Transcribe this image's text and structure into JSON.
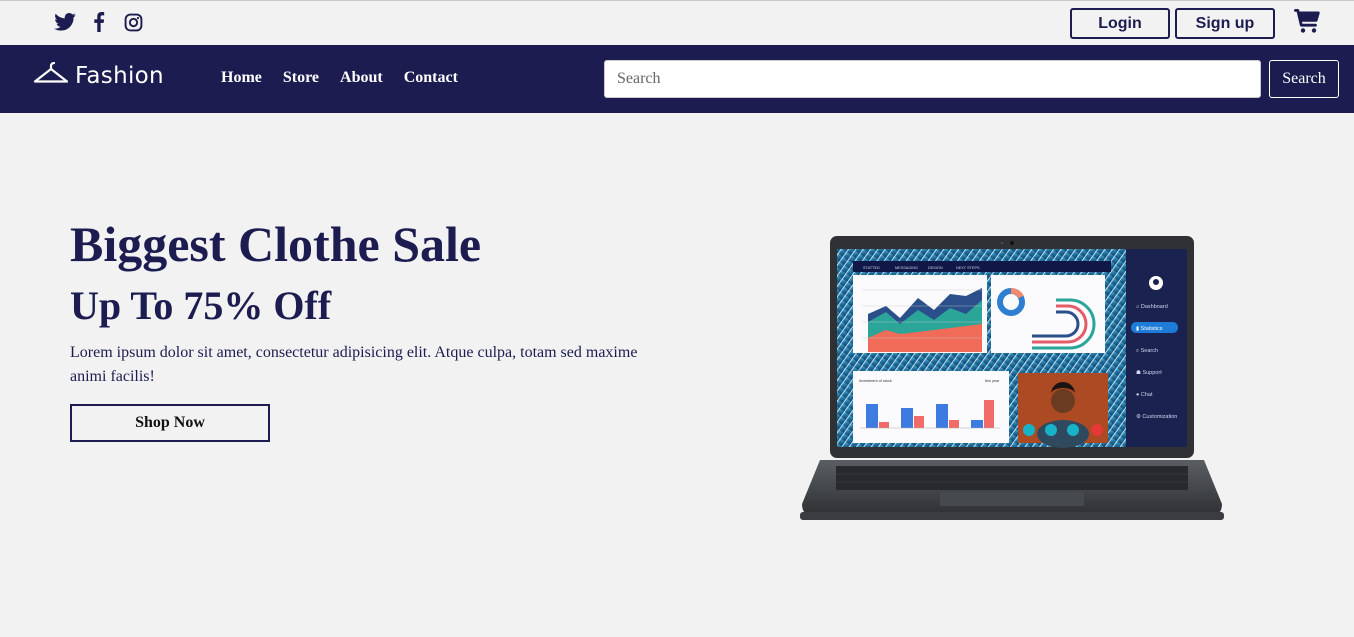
{
  "topbar": {
    "social": [
      {
        "icon": "twitter-icon"
      },
      {
        "icon": "facebook-icon"
      },
      {
        "icon": "instagram-icon"
      }
    ],
    "login_label": "Login",
    "signup_label": "Sign up",
    "cart_icon": "cart-icon"
  },
  "navbar": {
    "brand": "Fashion",
    "brand_icon": "hanger-icon",
    "links": [
      {
        "label": "Home"
      },
      {
        "label": "Store"
      },
      {
        "label": "About"
      },
      {
        "label": "Contact"
      }
    ],
    "search": {
      "placeholder": "Search",
      "value": "",
      "button_label": "Search"
    }
  },
  "hero": {
    "title": "Biggest Clothe Sale",
    "subtitle": "Up To 75% Off",
    "text": "Lorem ipsum dolor sit amet, consectetur adipisicing elit. Atque culpa, totam sed maxime animi facilis!",
    "cta_label": "Shop Now"
  },
  "laptop_screen": {
    "tabs": [
      "STATTED",
      "MESSAGING",
      "DESIGN",
      "NEXT STEPS"
    ],
    "sidebar": [
      "Dashboard",
      "Statistics",
      "Search",
      "Support",
      "Chat",
      "Customization"
    ],
    "active_item": "Statistics",
    "panel_title": "Investment of stock",
    "panel_tag": "this year"
  },
  "colors": {
    "navy": "#1c1c50",
    "background": "#f2f2f2",
    "white": "#ffffff"
  }
}
